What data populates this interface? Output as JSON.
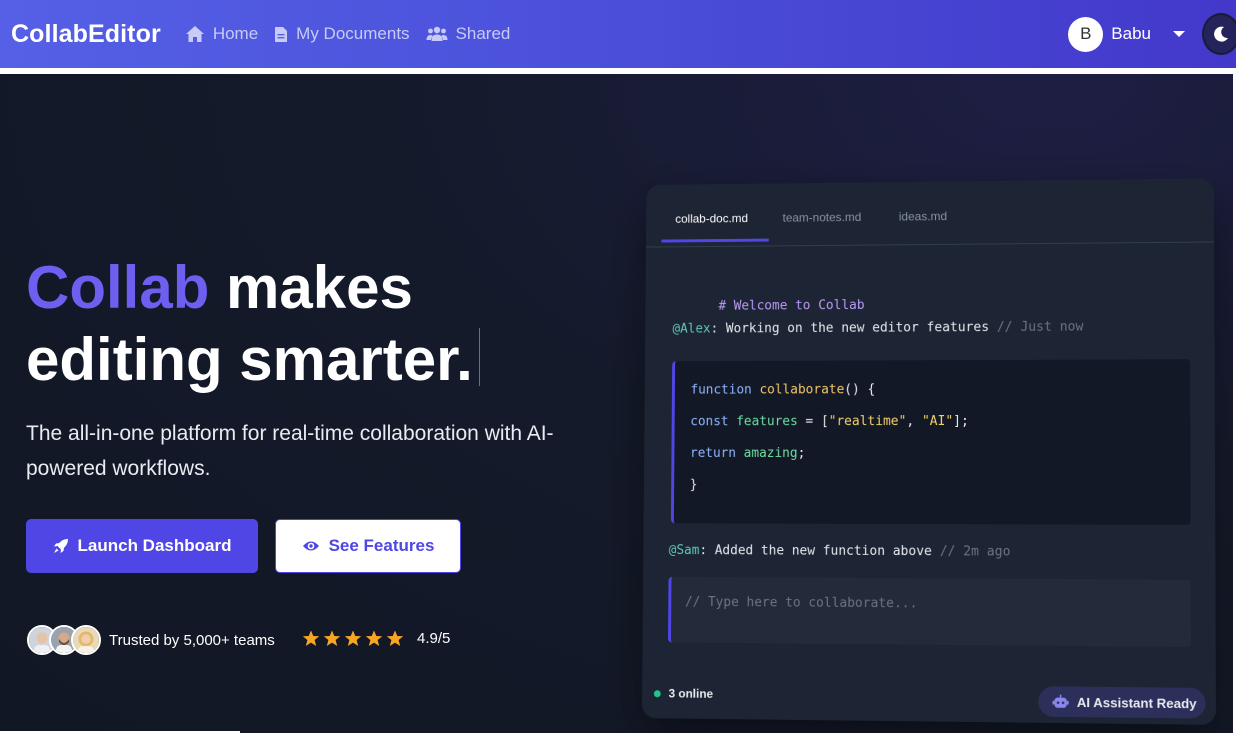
{
  "navbar": {
    "brand": "CollabEditor",
    "links": [
      {
        "label": "Home",
        "icon": "home-icon"
      },
      {
        "label": "My Documents",
        "icon": "document-icon"
      },
      {
        "label": "Shared",
        "icon": "users-icon"
      }
    ],
    "user": {
      "initial": "B",
      "name": "Babu"
    },
    "theme_toggle_icon": "moon-icon"
  },
  "hero": {
    "headline_accent": "Collab",
    "headline_rest_1": " makes",
    "headline_line_2": "editing smarter.",
    "subtitle": "The all-in-one platform for real-time collaboration with AI-powered workflows.",
    "primary_button": "Launch Dashboard",
    "secondary_button": "See Features",
    "trust_text": "Trusted by 5,000+ teams",
    "rating_stars": 5,
    "rating": "4.9/5"
  },
  "editor": {
    "tabs": [
      "collab-doc.md",
      "team-notes.md",
      "ideas.md"
    ],
    "active_tab": 0,
    "heading": "# Welcome to Collab",
    "comment1": {
      "user": "@Alex",
      "text": ": Working on the new editor features ",
      "time": "// Just now"
    },
    "code": {
      "line1_kw": "function ",
      "line1_fn": "collaborate",
      "line1_rest": "() {",
      "line2_kw": "const ",
      "line2_var": "features",
      "line2_eq": " = [",
      "line2_s1": "\"realtime\"",
      "line2_comma": ", ",
      "line2_s2": "\"AI\"",
      "line2_end": "];",
      "line3_kw": "return ",
      "line3_var": "amazing",
      "line3_end": ";",
      "line4": "}"
    },
    "comment2": {
      "user": "@Sam",
      "text": ": Added the new function above ",
      "time": "// 2m ago"
    },
    "input_placeholder": "// Type here to collaborate...",
    "online": "3 online",
    "ai_status": "AI Assistant Ready"
  },
  "colors": {
    "brand_gradient_start": "#5560e6",
    "brand_gradient_end": "#4338ca",
    "accent": "#5046e5",
    "online_green": "#22c58b",
    "star": "#f6a623"
  }
}
